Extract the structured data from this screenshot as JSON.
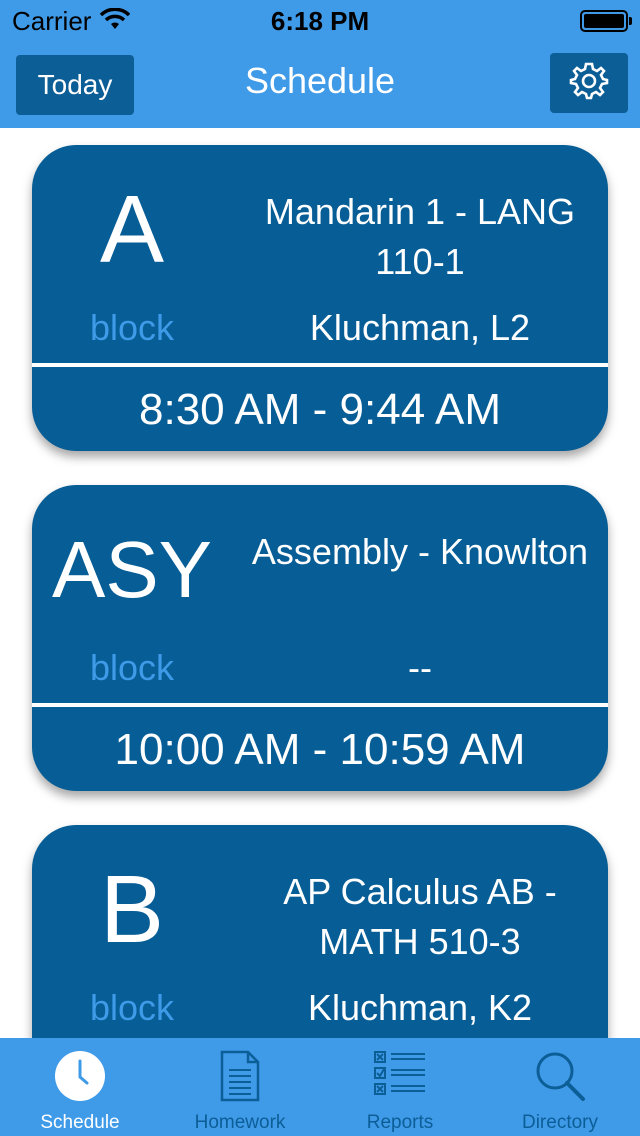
{
  "status_bar": {
    "carrier": "Carrier",
    "time": "6:18 PM"
  },
  "nav": {
    "today_label": "Today",
    "title": "Schedule",
    "settings_icon": "gear-icon"
  },
  "cards": [
    {
      "block": "A",
      "block_word": "block",
      "course": "Mandarin 1 - LANG 110-1",
      "teacher": "Kluchman, L2",
      "time": "8:30 AM - 9:44 AM"
    },
    {
      "block": "ASY",
      "block_word": "block",
      "course": "Assembly - Knowlton",
      "teacher": "--",
      "time": "10:00 AM - 10:59 AM"
    },
    {
      "block": "B",
      "block_word": "block",
      "course": "AP Calculus AB - MATH 510-3",
      "teacher": "Kluchman, K2",
      "time": ""
    }
  ],
  "tabs": [
    {
      "label": "Schedule",
      "icon": "clock-icon",
      "active": true
    },
    {
      "label": "Homework",
      "icon": "document-icon",
      "active": false
    },
    {
      "label": "Reports",
      "icon": "checklist-icon",
      "active": false
    },
    {
      "label": "Directory",
      "icon": "search-icon",
      "active": false
    }
  ],
  "colors": {
    "accent": "#3f9ae8",
    "card": "#075d96",
    "button": "#0c5e96",
    "text": "#ffffff"
  }
}
